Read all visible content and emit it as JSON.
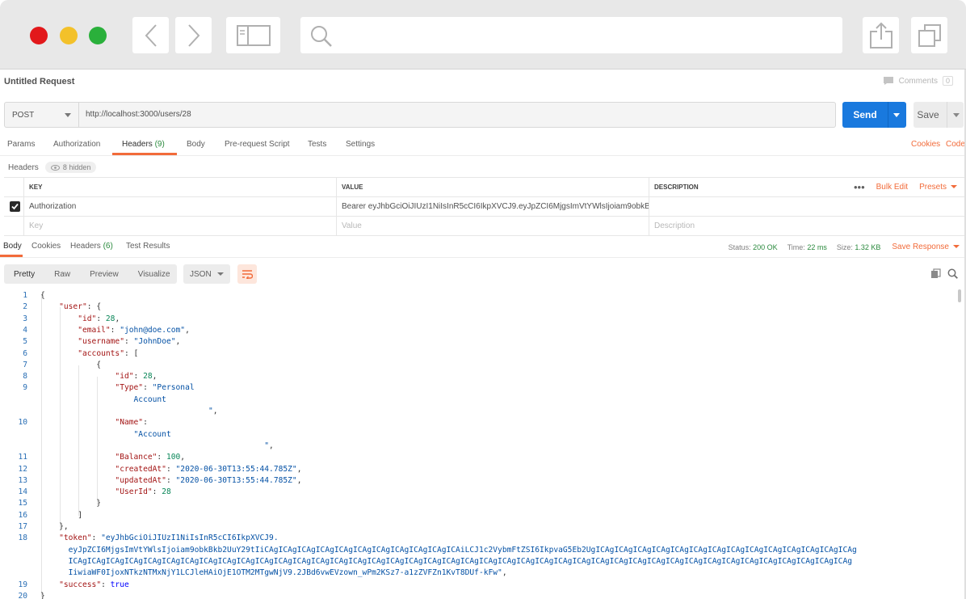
{
  "request": {
    "title": "Untitled Request",
    "comments_label": "Comments",
    "comments_count": "0",
    "method": "POST",
    "url": "http://localhost:3000/users/28",
    "send_label": "Send",
    "save_label": "Save"
  },
  "request_tabs": {
    "params": "Params",
    "authorization": "Authorization",
    "headers": "Headers",
    "headers_count": "(9)",
    "body": "Body",
    "prerequest": "Pre-request Script",
    "tests": "Tests",
    "settings": "Settings",
    "cookies": "Cookies",
    "code": "Code"
  },
  "headers_section": {
    "label": "Headers",
    "hidden": "8 hidden",
    "col_key": "KEY",
    "col_value": "VALUE",
    "col_description": "DESCRIPTION",
    "bulk_edit": "Bulk Edit",
    "presets": "Presets",
    "rows": [
      {
        "key": "Authorization",
        "value": "Bearer eyJhbGciOiJIUzI1NiIsInR5cCI6IkpXVCJ9.eyJpZCI6MjgsImVtYWlsIjoiam9obkBkl…",
        "description": "",
        "checked": true
      }
    ],
    "placeholder_key": "Key",
    "placeholder_value": "Value",
    "placeholder_description": "Description"
  },
  "response_tabs": {
    "body": "Body",
    "cookies": "Cookies",
    "headers": "Headers",
    "headers_count": "(6)",
    "test_results": "Test Results",
    "status_label": "Status:",
    "status_value": "200 OK",
    "time_label": "Time:",
    "time_value": "22 ms",
    "size_label": "Size:",
    "size_value": "1.32 KB",
    "save_response": "Save Response"
  },
  "view": {
    "pretty": "Pretty",
    "raw": "Raw",
    "preview": "Preview",
    "visualize": "Visualize",
    "format": "JSON"
  },
  "code_lines": [
    {
      "n": "1",
      "html": "{"
    },
    {
      "n": "2",
      "html": "    <span class=\"k\">\"user\"</span>: {"
    },
    {
      "n": "3",
      "html": "        <span class=\"k\">\"id\"</span>: <span class=\"n\">28</span>,"
    },
    {
      "n": "4",
      "html": "        <span class=\"k\">\"email\"</span>: <span class=\"s\">\"john@doe.com\"</span>,"
    },
    {
      "n": "5",
      "html": "        <span class=\"k\">\"username\"</span>: <span class=\"s\">\"JohnDoe\"</span>,"
    },
    {
      "n": "6",
      "html": "        <span class=\"k\">\"accounts\"</span>: ["
    },
    {
      "n": "7",
      "html": "            {"
    },
    {
      "n": "8",
      "html": "                <span class=\"k\">\"id\"</span>: <span class=\"n\">28</span>,"
    },
    {
      "n": "9",
      "html": "                <span class=\"k\">\"Type\"</span>: <span class=\"s\">\"Personal</span>"
    },
    {
      "n": "",
      "html": "                    <span class=\"s\">Account</span>"
    },
    {
      "n": "",
      "html": "                                    <span class=\"s\">\"</span>,"
    },
    {
      "n": "10",
      "html": "                <span class=\"k\">\"Name\"</span>:"
    },
    {
      "n": "",
      "html": "                    <span class=\"s\">\"Account</span>"
    },
    {
      "n": "",
      "html": "                                                <span class=\"s\">\"</span>,"
    },
    {
      "n": "11",
      "html": "                <span class=\"k\">\"Balance\"</span>: <span class=\"n\">100</span>,"
    },
    {
      "n": "12",
      "html": "                <span class=\"k\">\"createdAt\"</span>: <span class=\"s\">\"2020-06-30T13:55:44.785Z\"</span>,"
    },
    {
      "n": "13",
      "html": "                <span class=\"k\">\"updatedAt\"</span>: <span class=\"s\">\"2020-06-30T13:55:44.785Z\"</span>,"
    },
    {
      "n": "14",
      "html": "                <span class=\"k\">\"UserId\"</span>: <span class=\"n\">28</span>"
    },
    {
      "n": "15",
      "html": "            }"
    },
    {
      "n": "16",
      "html": "        ]"
    },
    {
      "n": "17",
      "html": "    },"
    },
    {
      "n": "18",
      "html": "    <span class=\"k\">\"token\"</span>: <span class=\"s\">\"eyJhbGciOiJIUzI1NiIsInR5cCI6IkpXVCJ9.</span>"
    },
    {
      "n": "",
      "html": "      <span class=\"s\">eyJpZCI6MjgsImVtYWlsIjoiam9obkBkb2UuY29tIiCAgICAgICAgICAgICAgICAgICAgICAgICAgICAgICAiLCJ1c2VybmFtZSI6IkpvaG5Eb2UgICAgICAgICAgICAgICAgICAgICAgICAgICAgICAgICAgICAgICAgICAg</span>"
    },
    {
      "n": "",
      "html": "      <span class=\"s\">ICAgICAgICAgICAgICAgICAgICAgICAgICAgICAgICAgICAgICAgICAgICAgICAgICAgICAgICAgICAgICAgICAgICAgICAgICAgICAgICAgICAgICAgICAgICAgICAgICAgICAgICAgICAgICAgICAgICAgICAgICAgICAg</span>"
    },
    {
      "n": "",
      "html": "      <span class=\"s\">IiwiaWF0IjoxNTkzNTMxNjY1LCJleHAiOjE1OTM2MTgwNjV9.2JBd6vwEVzown_wPm2KSz7-a1zZVFZn1KvT8DUf-kFw\"</span>,"
    },
    {
      "n": "19",
      "html": "    <span class=\"k\">\"success\"</span>: <span class=\"b\">true</span>"
    },
    {
      "n": "20",
      "html": "}"
    }
  ]
}
